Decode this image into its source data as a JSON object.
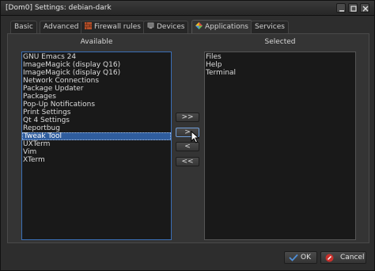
{
  "window": {
    "title": "[Dom0] Settings: debian-dark"
  },
  "tabs": [
    {
      "label": "Basic",
      "icon": ""
    },
    {
      "label": "Advanced",
      "icon": ""
    },
    {
      "label": "Firewall rules",
      "icon": "firewall-icon"
    },
    {
      "label": "Devices",
      "icon": "devices-icon"
    },
    {
      "label": "Applications",
      "icon": "applications-icon",
      "active": true
    },
    {
      "label": "Services",
      "icon": ""
    }
  ],
  "available": {
    "header": "Available",
    "items": [
      "GNU Emacs 24",
      "ImageMagick (display Q16)",
      "ImageMagick (display Q16)",
      "Network Connections",
      "Package Updater",
      "Packages",
      "Pop-Up Notifications",
      "Print Settings",
      "Qt 4 Settings",
      "Reportbug",
      "Tweak Tool",
      "UXTerm",
      "Vim",
      "XTerm"
    ],
    "selected_item": "Tweak Tool"
  },
  "selected": {
    "header": "Selected",
    "items": [
      "Files",
      "Help",
      "Terminal"
    ]
  },
  "move_buttons": {
    "add_all": ">>",
    "add": ">",
    "remove": "<",
    "remove_all": "<<"
  },
  "footer": {
    "ok_label": "OK",
    "cancel_label": "Cancel"
  },
  "colors": {
    "selection": "#2f5d9e",
    "list_bg": "#191919",
    "window_bg": "#2d2d2d"
  }
}
